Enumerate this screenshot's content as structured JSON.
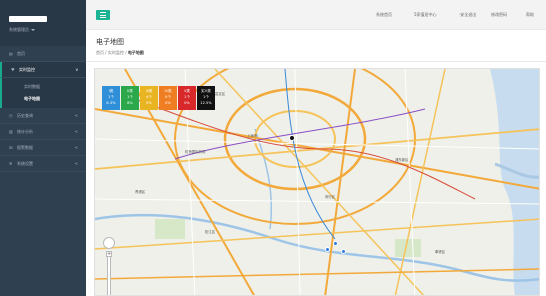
{
  "sidebar": {
    "profile_role": "系统管理员",
    "items": [
      {
        "label": "首页",
        "icon": "home-icon",
        "arrow": ""
      },
      {
        "label": "实时监控",
        "icon": "monitor-icon",
        "arrow": "v"
      },
      {
        "label": "历史查询",
        "icon": "history-icon",
        "arrow": "<"
      },
      {
        "label": "统计分析",
        "icon": "chart-icon",
        "arrow": "<"
      },
      {
        "label": "报警数据",
        "icon": "alarm-icon",
        "arrow": "<"
      },
      {
        "label": "系统设置",
        "icon": "gear-icon",
        "arrow": "<"
      }
    ],
    "submenu": [
      "实时数据",
      "电子地图"
    ]
  },
  "topbar": {
    "items": [
      "系统首页",
      "5家值班中心",
      "·安全退出",
      "修改密码",
      "帮助"
    ]
  },
  "header": {
    "title": "电子地图",
    "crumb_home": "首页",
    "crumb_parent": "实时监控",
    "crumb_current": "电子地图"
  },
  "legend": [
    {
      "name": "I类",
      "count": "1个",
      "pct": "8.3%",
      "color": "#2f8fd8"
    },
    {
      "name": "II类",
      "count": "1个",
      "pct": "8%",
      "color": "#2aa84a"
    },
    {
      "name": "III类",
      "count": "4个",
      "pct": "0%",
      "color": "#e9b421"
    },
    {
      "name": "IV类",
      "count": "0个",
      "pct": "0%",
      "color": "#ef7d22"
    },
    {
      "name": "V类",
      "count": "1个",
      "pct": "0%",
      "color": "#d8282a"
    },
    {
      "name": "劣V类",
      "count": "1个",
      "pct": "12.5%",
      "color": "#111111"
    }
  ],
  "map_labels": [
    "上海市",
    "虹桥国际机场",
    "浦东新区",
    "松江区",
    "闵行区",
    "嘉定区",
    "青浦区",
    "奉贤区"
  ]
}
